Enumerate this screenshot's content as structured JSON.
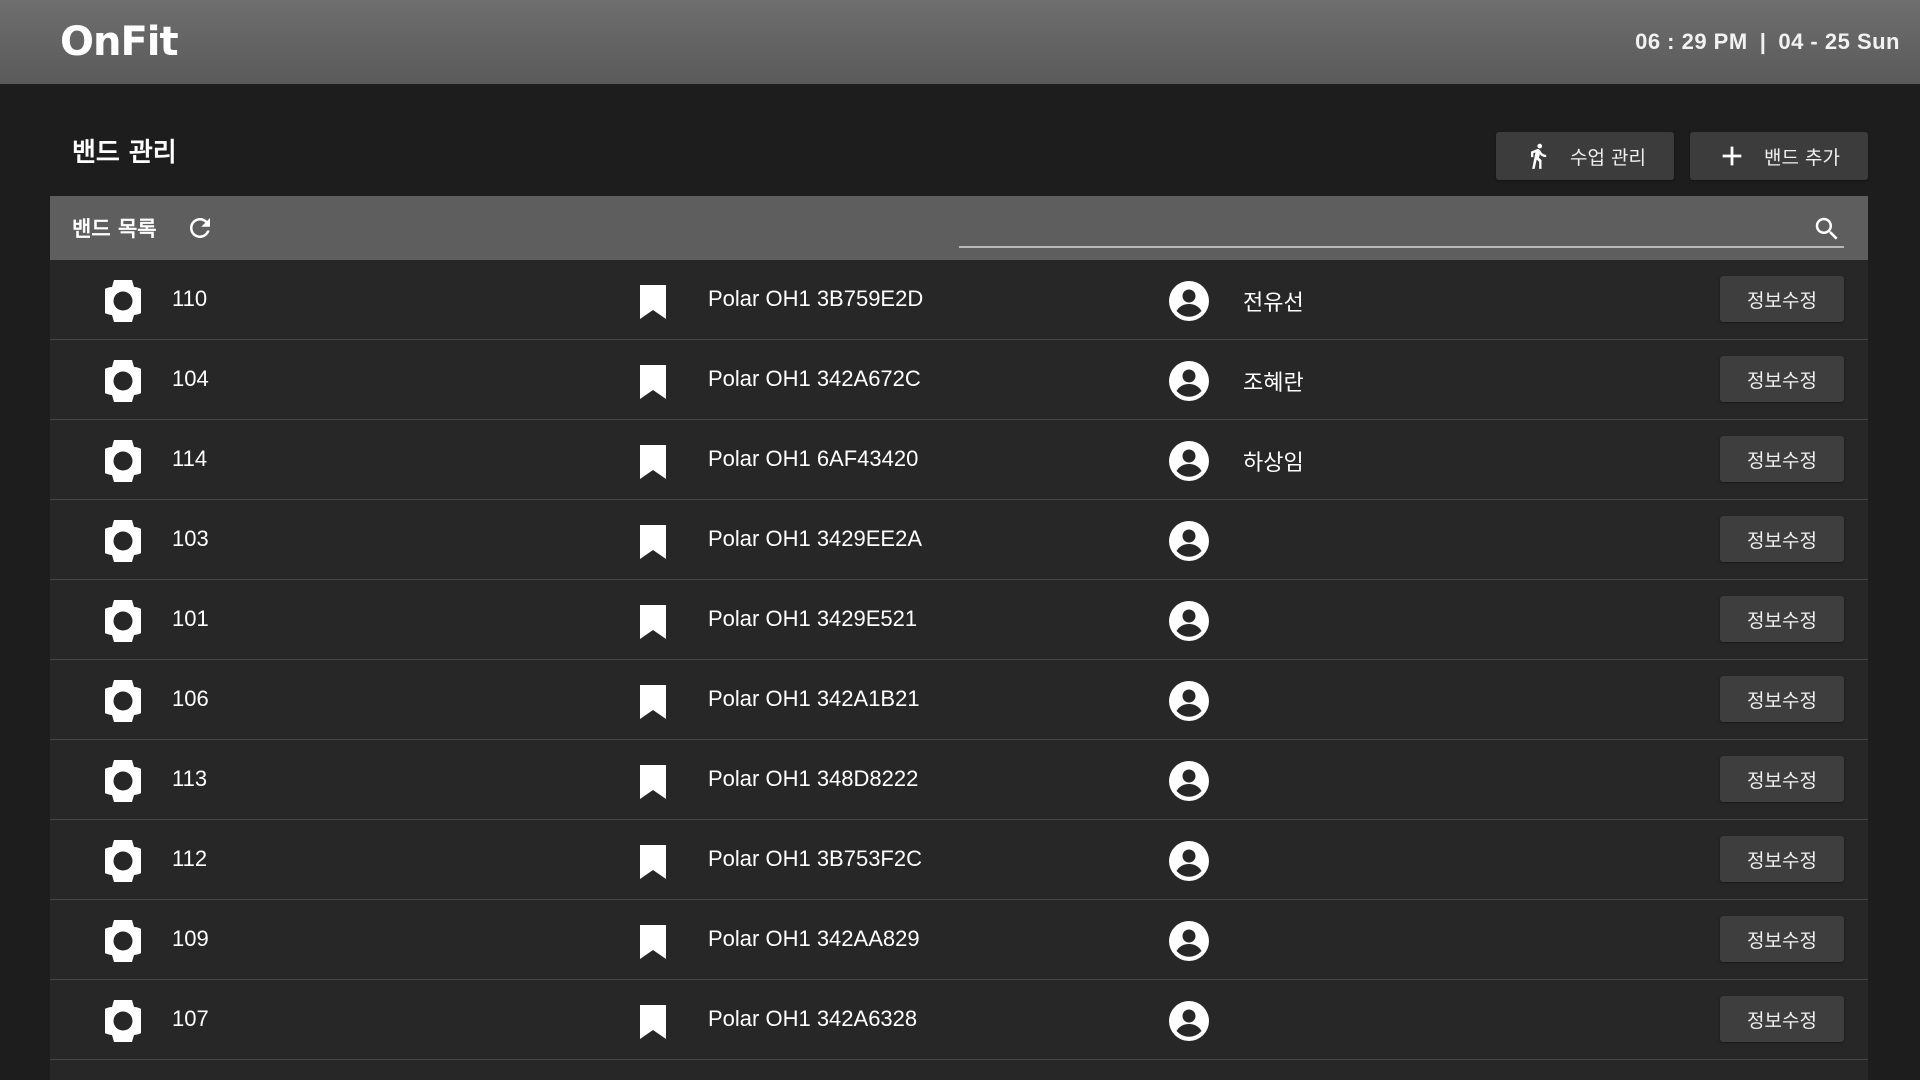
{
  "app": {
    "logo": "OnFit"
  },
  "clock": {
    "time": "06 : 29  PM",
    "separator": "|",
    "date": "04 - 25  Sun"
  },
  "page": {
    "title": "밴드 관리"
  },
  "buttons": {
    "class_manage": {
      "label": "수업 관리",
      "icon": "running-person-icon"
    },
    "add_band": {
      "label": "밴드 추가",
      "icon": "plus-icon"
    }
  },
  "panel": {
    "title": "밴드 목록",
    "refresh_icon": "refresh-icon",
    "search": {
      "placeholder": "",
      "value": "",
      "icon": "search-icon"
    }
  },
  "rows": [
    {
      "number": "110",
      "device": "Polar OH1 3B759E2D",
      "user": "전유선",
      "action": "정보수정"
    },
    {
      "number": "104",
      "device": "Polar OH1 342A672C",
      "user": "조혜란",
      "action": "정보수정"
    },
    {
      "number": "114",
      "device": "Polar OH1 6AF43420",
      "user": "하상임",
      "action": "정보수정"
    },
    {
      "number": "103",
      "device": "Polar OH1 3429EE2A",
      "user": "",
      "action": "정보수정"
    },
    {
      "number": "101",
      "device": "Polar OH1 3429E521",
      "user": "",
      "action": "정보수정"
    },
    {
      "number": "106",
      "device": "Polar OH1 342A1B21",
      "user": "",
      "action": "정보수정"
    },
    {
      "number": "113",
      "device": "Polar OH1 348D8222",
      "user": "",
      "action": "정보수정"
    },
    {
      "number": "112",
      "device": "Polar OH1 3B753F2C",
      "user": "",
      "action": "정보수정"
    },
    {
      "number": "109",
      "device": "Polar OH1 342AA829",
      "user": "",
      "action": "정보수정"
    },
    {
      "number": "107",
      "device": "Polar OH1 342A6328",
      "user": "",
      "action": "정보수정"
    }
  ],
  "colors": {
    "background": "#1d1d1d",
    "topbar": "#5a5a5a",
    "panel_header": "#5e5e5e",
    "row_bg": "#272727",
    "button_bg": "#3e3e3e",
    "text": "#ffffff"
  }
}
